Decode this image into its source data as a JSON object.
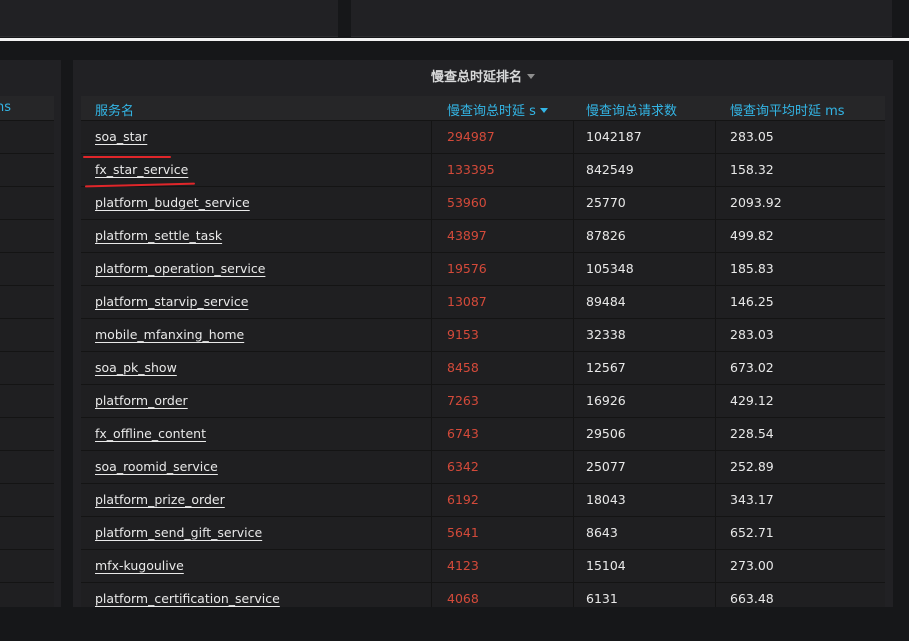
{
  "panel": {
    "title": "慢查总时延排名"
  },
  "left_panel": {
    "header_fragment": "ns"
  },
  "table": {
    "headers": {
      "service": "服务名",
      "total_latency": "慢查询总时延 s",
      "request_count": "慢查询总请求数",
      "avg_latency": "慢查询平均时延 ms"
    },
    "sorted_by": "total_latency",
    "sort_direction": "desc",
    "rows": [
      {
        "service": "soa_star",
        "total": "294987",
        "count": "1042187",
        "avg": "283.05"
      },
      {
        "service": "fx_star_service",
        "total": "133395",
        "count": "842549",
        "avg": "158.32"
      },
      {
        "service": "platform_budget_service",
        "total": "53960",
        "count": "25770",
        "avg": "2093.92"
      },
      {
        "service": "platform_settle_task",
        "total": "43897",
        "count": "87826",
        "avg": "499.82"
      },
      {
        "service": "platform_operation_service",
        "total": "19576",
        "count": "105348",
        "avg": "185.83"
      },
      {
        "service": "platform_starvip_service",
        "total": "13087",
        "count": "89484",
        "avg": "146.25"
      },
      {
        "service": "mobile_mfanxing_home",
        "total": "9153",
        "count": "32338",
        "avg": "283.03"
      },
      {
        "service": "soa_pk_show",
        "total": "8458",
        "count": "12567",
        "avg": "673.02"
      },
      {
        "service": "platform_order",
        "total": "7263",
        "count": "16926",
        "avg": "429.12"
      },
      {
        "service": "fx_offline_content",
        "total": "6743",
        "count": "29506",
        "avg": "228.54"
      },
      {
        "service": "soa_roomid_service",
        "total": "6342",
        "count": "25077",
        "avg": "252.89"
      },
      {
        "service": "platform_prize_order",
        "total": "6192",
        "count": "18043",
        "avg": "343.17"
      },
      {
        "service": "platform_send_gift_service",
        "total": "5641",
        "count": "8643",
        "avg": "652.71"
      },
      {
        "service": "mfx-kugoulive",
        "total": "4123",
        "count": "15104",
        "avg": "273.00"
      },
      {
        "service": "platform_certification_service",
        "total": "4068",
        "count": "6131",
        "avg": "663.48"
      }
    ]
  },
  "colors": {
    "header_text": "#33b5e5",
    "total_value": "#d44a3a",
    "panel_bg": "#212124",
    "annotation": "#e0262a"
  },
  "icons": {
    "title_caret": "chevron-down-icon",
    "sort_caret": "sort-desc-icon"
  }
}
